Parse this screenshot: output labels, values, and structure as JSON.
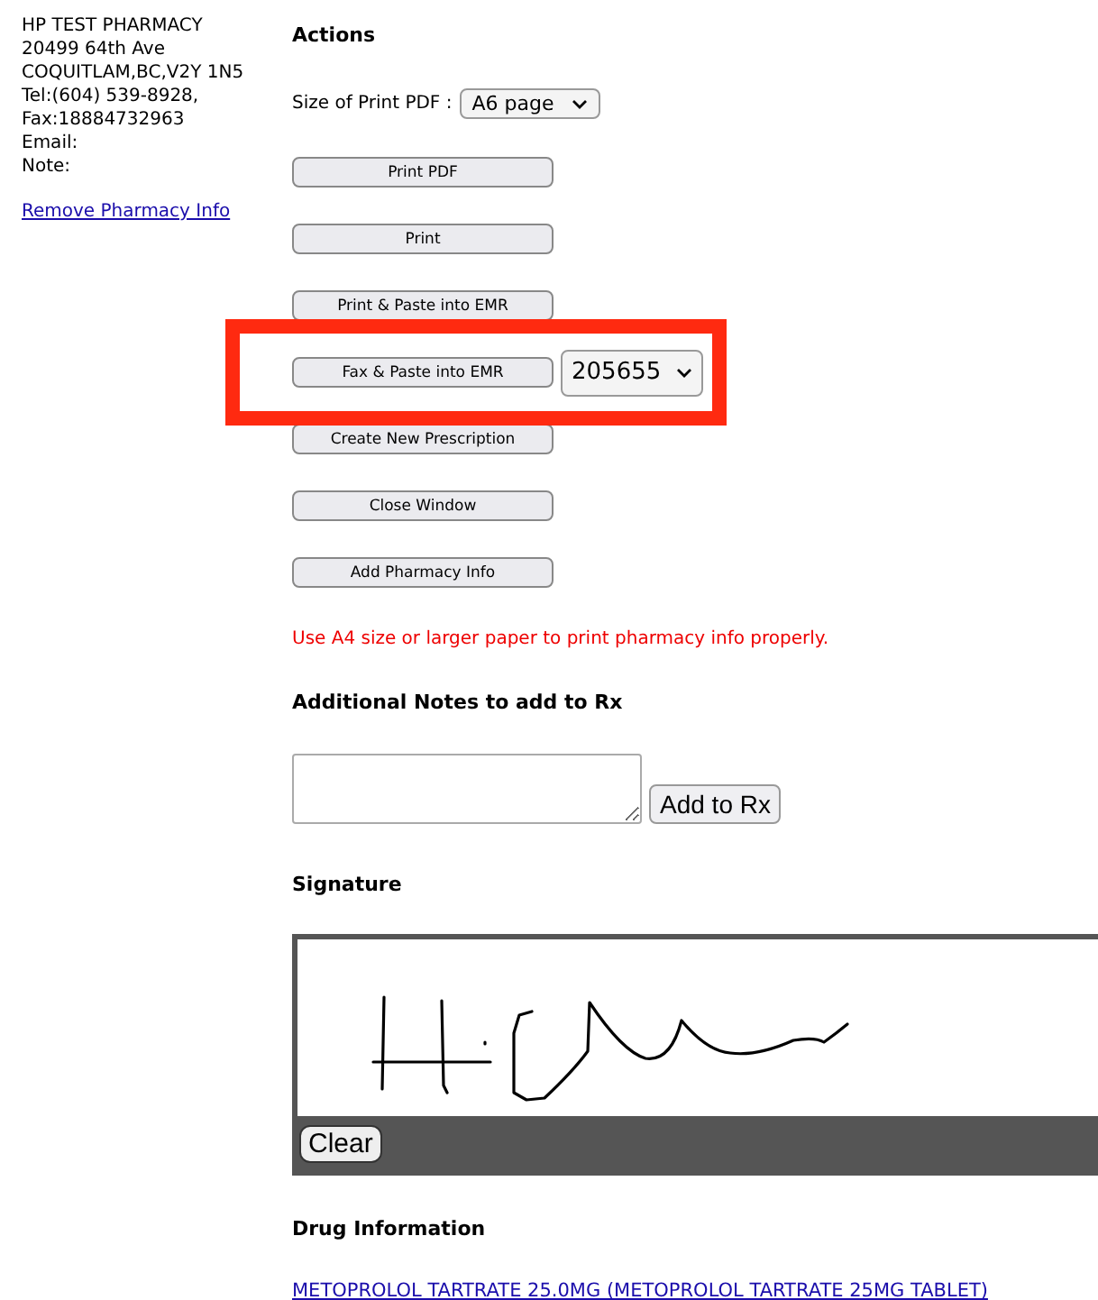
{
  "pharmacy": {
    "lines": [
      "HP TEST PHARMACY",
      "20499 64th Ave",
      "COQUITLAM,BC,V2Y 1N5",
      "Tel:(604) 539-8928,",
      "Fax:18884732963",
      "Email:",
      "Note:"
    ],
    "remove_link": "Remove Pharmacy Info"
  },
  "actions": {
    "heading": "Actions",
    "print_size": {
      "label": "Size of Print PDF :",
      "value": "A6 page"
    },
    "buttons": [
      {
        "kind": "button",
        "label": "Print PDF"
      },
      {
        "kind": "button",
        "label": "Print"
      },
      {
        "kind": "button",
        "label": "Print & Paste into EMR"
      },
      {
        "kind": "button_with_select",
        "label": "Fax & Paste into EMR",
        "select_value": "205655",
        "highlighted": true
      },
      {
        "kind": "button",
        "label": "Create New Prescription"
      },
      {
        "kind": "button",
        "label": "Close Window"
      },
      {
        "kind": "button",
        "label": "Add Pharmacy Info"
      }
    ],
    "warning": "Use A4 size or larger paper to print pharmacy info properly."
  },
  "notes": {
    "heading": "Additional Notes to add to Rx",
    "button": "Add to Rx"
  },
  "signature": {
    "heading": "Signature",
    "clear_button": "Clear"
  },
  "drug_information": {
    "heading": "Drug Information",
    "link": "METOPROLOL TARTRATE 25.0MG (METOPROLOL TARTRATE 25MG TABLET)"
  }
}
